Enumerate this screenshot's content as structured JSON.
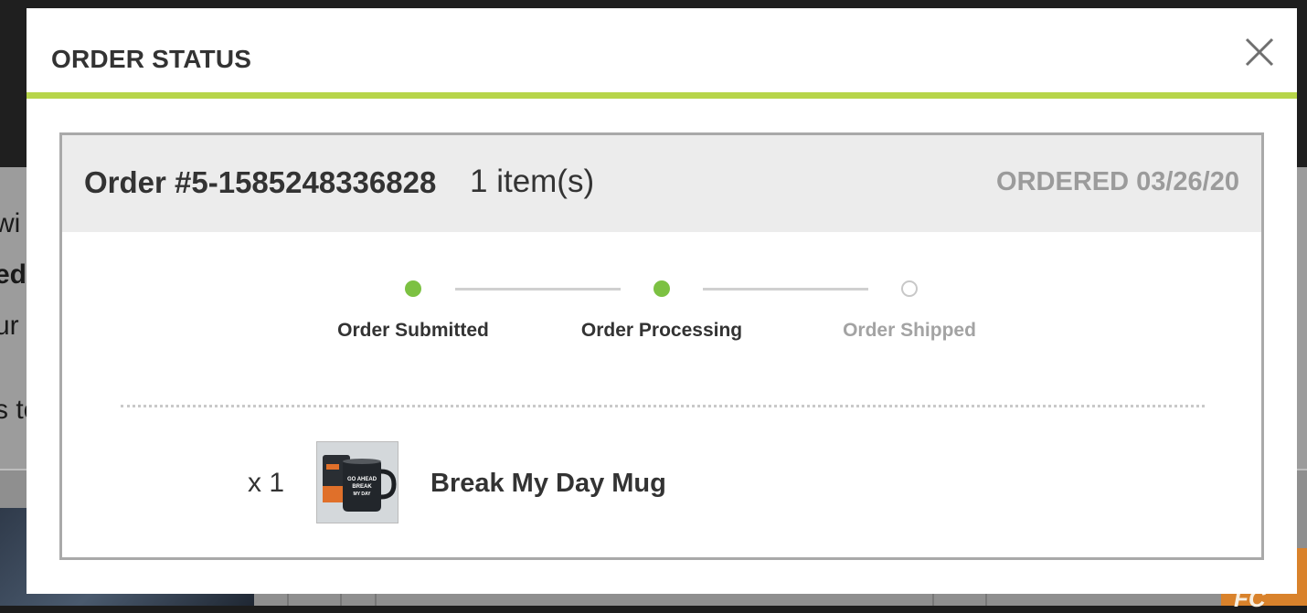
{
  "background": {
    "text_fragments": [
      "wi",
      "ed",
      "ur",
      "s to"
    ],
    "promo_fragment": "FC"
  },
  "modal": {
    "title": "ORDER STATUS",
    "close_icon": "close-icon",
    "accent_color": "#b7d54a"
  },
  "order": {
    "number": "Order #5-1585248336828",
    "item_count": "1 item(s)",
    "ordered_date": "ORDERED 03/26/20"
  },
  "progress": {
    "steps": [
      {
        "label": "Order Submitted",
        "status": "complete"
      },
      {
        "label": "Order Processing",
        "status": "complete"
      },
      {
        "label": "Order Shipped",
        "status": "pending"
      }
    ],
    "complete_color": "#7cc142"
  },
  "items": [
    {
      "quantity": "x 1",
      "name": "Break My Day Mug",
      "thumbnail_icon": "mug-icon",
      "mug_text": [
        "GO AHEAD",
        "BREAK",
        "MY DAY"
      ]
    }
  ]
}
